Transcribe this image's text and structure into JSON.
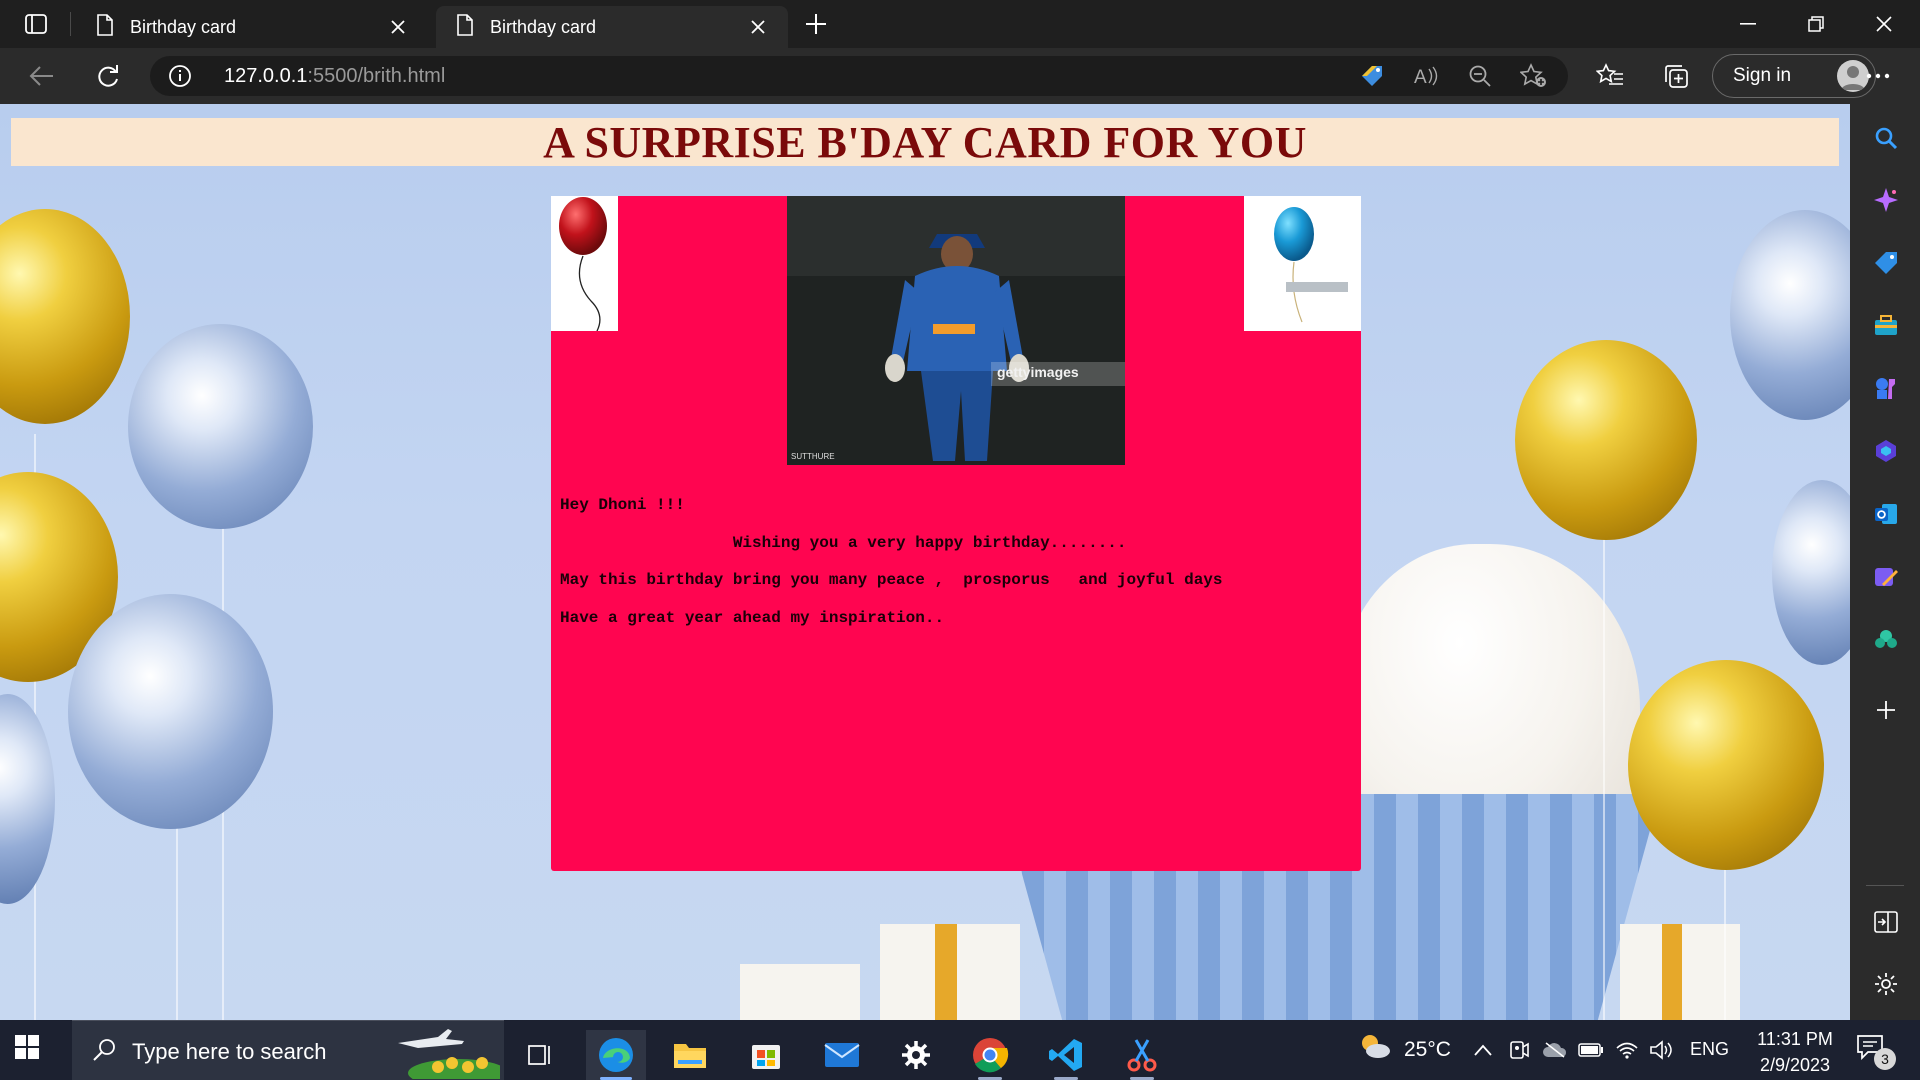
{
  "browser": {
    "tabs": [
      {
        "title": "Birthday card",
        "active": false
      },
      {
        "title": "Birthday card",
        "active": true
      }
    ],
    "address": {
      "host": "127.0.0.1",
      "rest": ":5500/brith.html"
    },
    "signin_label": "Sign in",
    "icons": {
      "tab_actions": "tab-actions-icon",
      "page": "page-icon",
      "close": "close-icon",
      "new_tab": "plus-icon",
      "back": "back-arrow-icon",
      "refresh": "refresh-icon",
      "site_info": "info-icon",
      "coupons": "tag-icon",
      "read_aloud": "read-aloud-icon",
      "zoom_out": "zoom-out-icon",
      "add_favorite": "star-plus-icon",
      "favorites": "favorites-icon",
      "collections": "collections-icon",
      "more": "more-icon"
    }
  },
  "sidebar": {
    "items": [
      "search-icon",
      "copilot-icon",
      "shopping-icon",
      "tools-icon",
      "games-icon",
      "microsoft-365-icon",
      "outlook-icon",
      "designer-icon",
      "drop-icon",
      "add-icon",
      "split-screen-icon",
      "settings-icon"
    ]
  },
  "page": {
    "heading": "A SURPRISE B'DAY CARD FOR YOU",
    "card": {
      "photo_watermark": "gettyimages",
      "photo_caption": "SUTTHURE",
      "lines": [
        "Hey Dhoni !!!",
        "                  Wishing you a very happy birthday........",
        "May this birthday bring you many peace ,  prosporus   and joyful days",
        "Have a great year ahead my inspiration.."
      ]
    },
    "colors": {
      "header_bg": "#fae6cf",
      "header_text": "#7a0a0a",
      "card_bg": "#ff0550",
      "background": "#c3d5f2"
    }
  },
  "taskbar": {
    "search_placeholder": "Type here to search",
    "weather": "25°C",
    "language": "ENG",
    "time": "11:31 PM",
    "date": "2/9/2023",
    "notifications": "3",
    "apps": [
      "task-view-icon",
      "edge-icon",
      "file-explorer-icon",
      "microsoft-store-icon",
      "mail-icon",
      "settings-icon",
      "chrome-icon",
      "vscode-icon",
      "snipping-tool-icon"
    ]
  }
}
